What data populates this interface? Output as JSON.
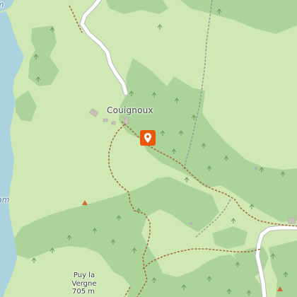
{
  "map": {
    "place_label": "Couignoux",
    "peak": {
      "name_line1": "Puy la",
      "name_line2": "Vergne",
      "elevation": "705 m"
    },
    "water_label_top": "am",
    "water_label_left": "am"
  },
  "colors": {
    "meadow": "#cfe8b4",
    "forest": "#acd49a",
    "water": "#aad3df",
    "road": "#ffffff",
    "road_casing": "#b9b9b9",
    "path": "#a36a3d",
    "track": "#9a9a9a",
    "marker": "#e8590c",
    "peak_triangle": "#d36a35"
  },
  "icons": {
    "poi_marker": "map-pin-icon",
    "peak": "peak-triangle-icon",
    "tree": "tree-icon"
  }
}
